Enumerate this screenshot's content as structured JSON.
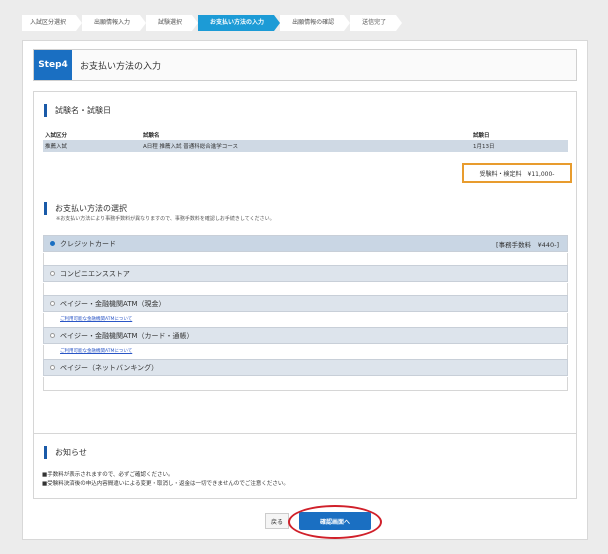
{
  "breadcrumb": [
    {
      "label": "入試区分選択",
      "active": false
    },
    {
      "label": "出願情報入力",
      "active": false
    },
    {
      "label": "試験選択",
      "active": false
    },
    {
      "label": "お支払い方法の入力",
      "active": true
    },
    {
      "label": "出願情報の確認",
      "active": false
    },
    {
      "label": "送信完了",
      "active": false
    }
  ],
  "step": {
    "badge": "Step4",
    "title": "お支払い方法の入力"
  },
  "exam": {
    "section_title": "試験名・試験日",
    "headers": [
      "入試区分",
      "試験名",
      "試験日"
    ],
    "row": [
      "推薦入試",
      "A日程 推薦入試 普通科総合進学コース",
      "1月13日"
    ],
    "fee": "受験料・検定料　¥11,000-"
  },
  "payment": {
    "section_title": "お支払い方法の選択",
    "note": "※お支払い方法により事務手数料が異なりますので、事務手数料を確認しお手続きしてください。",
    "options": [
      {
        "label": "クレジットカード",
        "fee": "[事務手数料　¥440-]",
        "selected": true,
        "link": ""
      },
      {
        "label": "コンビニエンスストア",
        "fee": "",
        "selected": false,
        "link": ""
      },
      {
        "label": "ペイジー・金融機関ATM（現金）",
        "fee": "",
        "selected": false,
        "link": "ご利用可能な金融機関ATMについて"
      },
      {
        "label": "ペイジー・金融機関ATM（カード・通帳）",
        "fee": "",
        "selected": false,
        "link": "ご利用可能な金融機関ATMについて"
      },
      {
        "label": "ペイジー（ネットバンキング）",
        "fee": "",
        "selected": false,
        "link": ""
      }
    ]
  },
  "notice": {
    "title": "お知らせ",
    "lines": [
      "■手数料が表示されますので、必ずご確認ください。",
      "■受験料決済後の申込内容間違いによる変更・取消し・返金は一切できませんのでご注意ください。"
    ]
  },
  "buttons": {
    "back": "戻る",
    "confirm": "確認画面へ"
  },
  "colors": {
    "accent": "#1a6fc2",
    "highlight_ring": "#d0202a",
    "fee_border": "#e89c2e"
  }
}
